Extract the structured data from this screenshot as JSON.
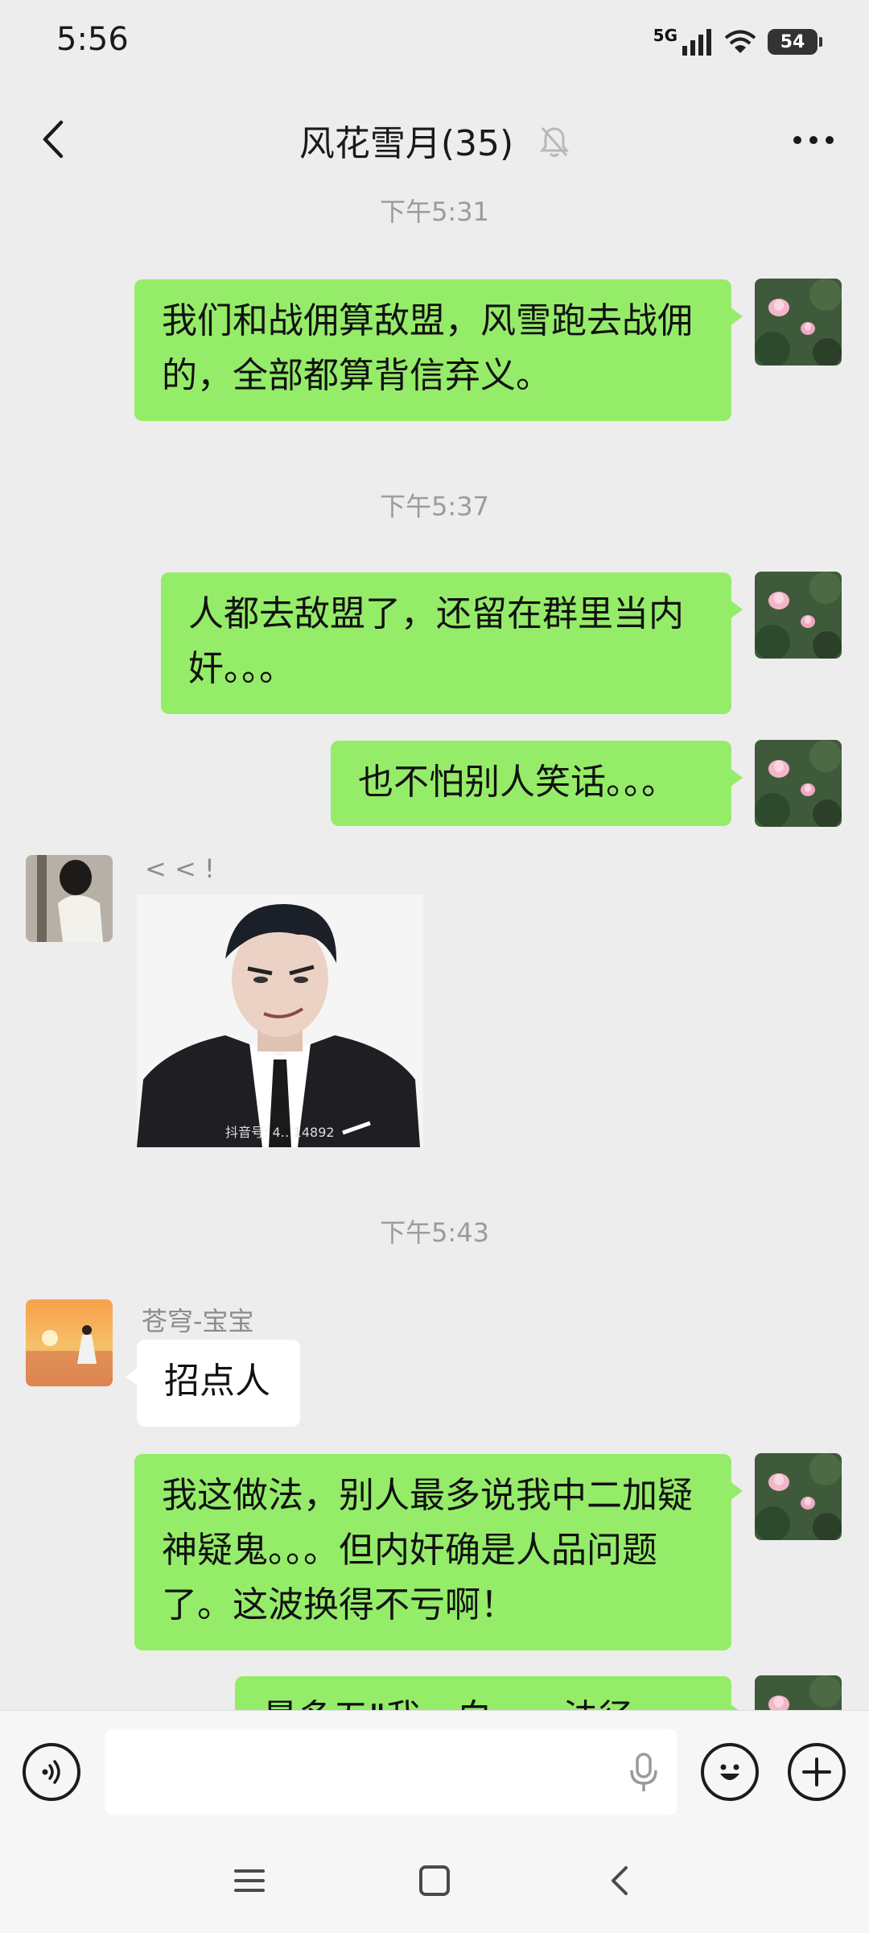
{
  "status_bar": {
    "time": "5:56",
    "network": "5G",
    "battery": "54"
  },
  "header": {
    "title": "风花雪月(35)"
  },
  "messages": {
    "ts1": "下午5:31",
    "m1": "我们和战佣算敌盟，风雪跑去战佣的，全部都算背信弃义。",
    "ts2": "下午5:37",
    "m2": "人都去敌盟了，还留在群里当内奸。。。",
    "m3": "也不怕别人笑话。。。",
    "sender1": "< < !",
    "sticker_watermark": "抖音号: 4…14892",
    "ts3": "下午5:43",
    "sender2": "苍穹-宝宝",
    "m4": "招点人",
    "m5": "我这做法，别人最多说我中二加疑神疑鬼。。。但内奸确是人品问题了。这波换得不亏啊！",
    "m6": "最多五Ⅱ我，白……法径"
  },
  "input": {
    "placeholder": ""
  },
  "colors": {
    "my_bubble": "#95ec69",
    "other_bubble": "#ffffff",
    "background": "#ededed"
  }
}
